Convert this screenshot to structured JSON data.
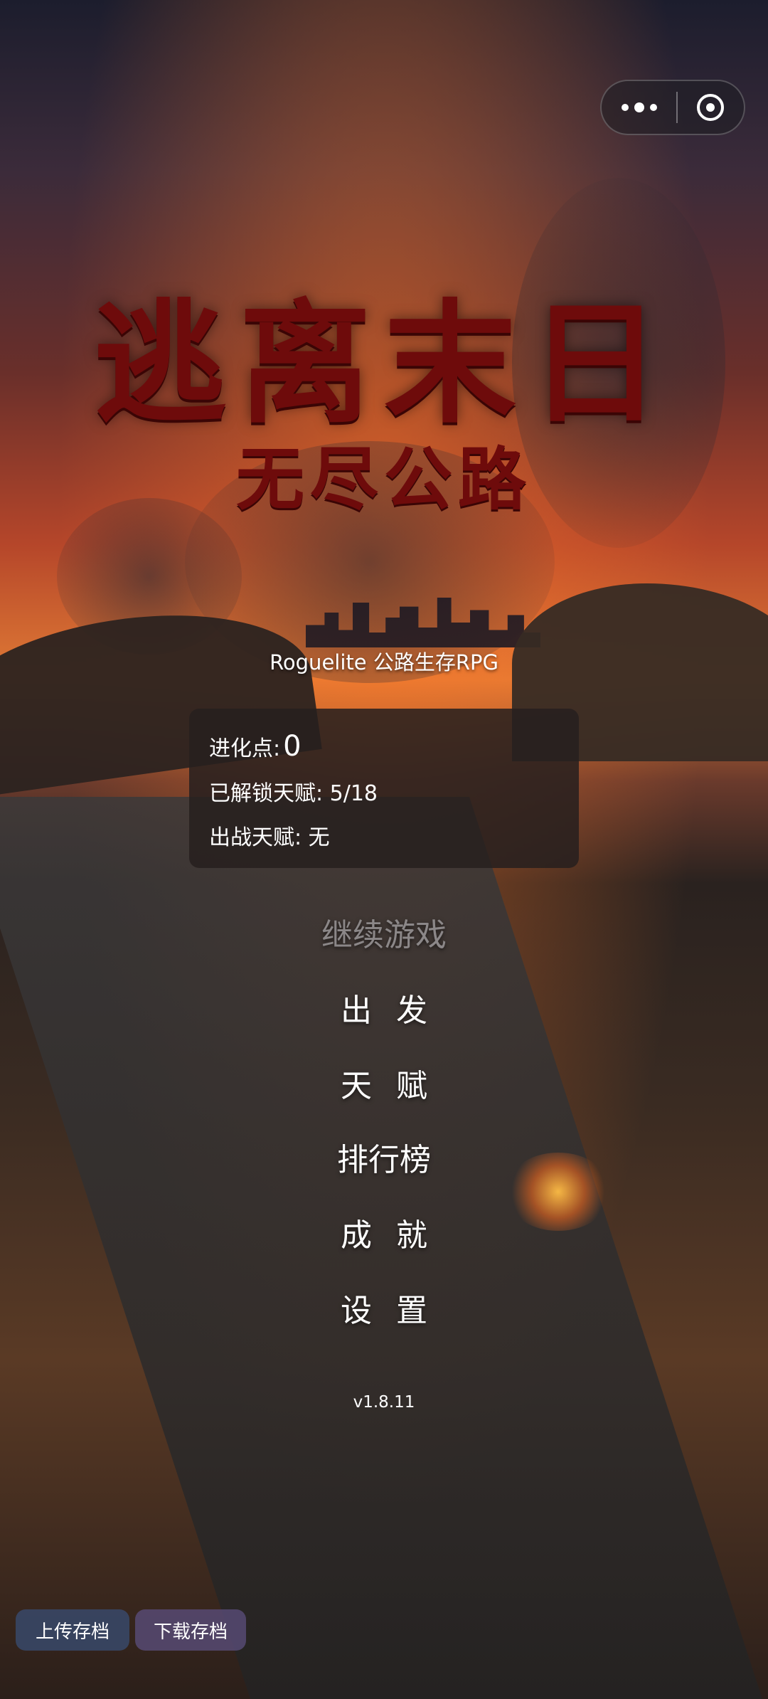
{
  "header": {
    "more_icon": "more-dots-icon",
    "capsule_icon": "target-circle-icon"
  },
  "title": {
    "main": "逃离末日",
    "sub": "无尽公路",
    "tagline": "Roguelite 公路生存RPG"
  },
  "stats": {
    "evolution_label": "进化点:",
    "evolution_value": "0",
    "unlocked_label": "已解锁天赋: 5/18",
    "active_label": "出战天赋: 无"
  },
  "menu": {
    "continue": "继续游戏",
    "start": "出发",
    "talent": "天赋",
    "leaderboard": "排行榜",
    "achievements": "成就",
    "settings": "设置"
  },
  "version": "v1.8.11",
  "footer": {
    "upload": "上传存档",
    "download": "下载存档"
  }
}
